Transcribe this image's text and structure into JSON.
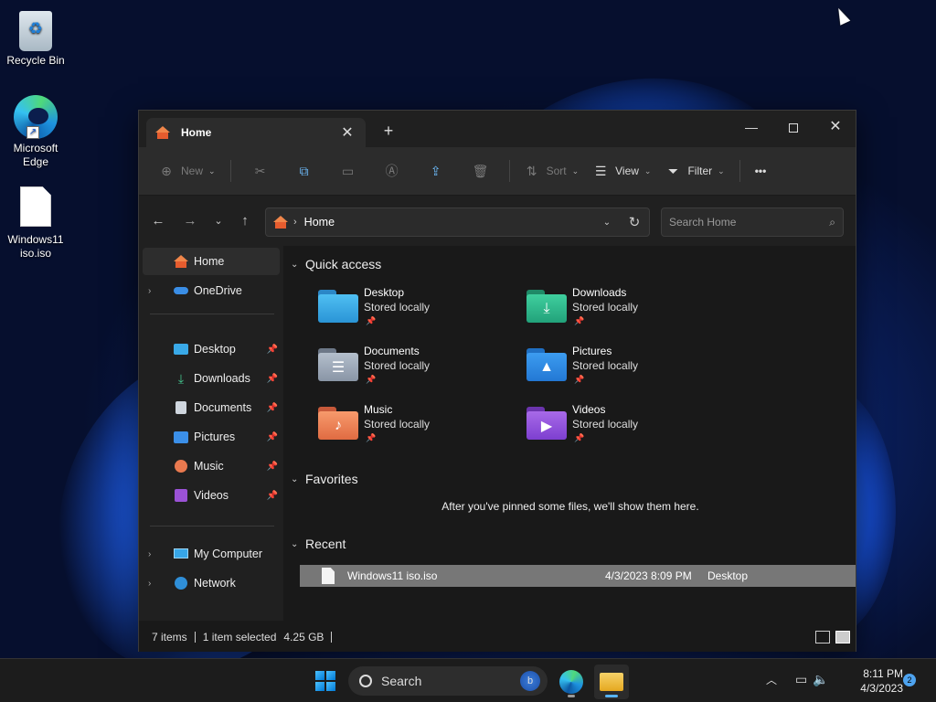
{
  "desktop": {
    "icons": [
      {
        "label": "Recycle Bin"
      },
      {
        "label": "Microsoft Edge"
      },
      {
        "label": "Windows11 iso.iso"
      }
    ]
  },
  "window": {
    "tab_title": "Home",
    "toolbar": {
      "new_label": "New",
      "sort_label": "Sort",
      "view_label": "View",
      "filter_label": "Filter",
      "more_label": "•••"
    },
    "address": {
      "path": "Home"
    },
    "search": {
      "placeholder": "Search Home"
    },
    "sidebar": {
      "home": "Home",
      "onedrive": "OneDrive",
      "pinned": [
        "Desktop",
        "Downloads",
        "Documents",
        "Pictures",
        "Music",
        "Videos"
      ],
      "my_computer": "My Computer",
      "network": "Network"
    },
    "quick_access": {
      "heading": "Quick access",
      "items": [
        {
          "name": "Desktop",
          "status": "Stored locally",
          "color": "#39a9e8"
        },
        {
          "name": "Downloads",
          "status": "Stored locally",
          "color": "#30b58a"
        },
        {
          "name": "Documents",
          "status": "Stored locally",
          "color": "#8a97a8"
        },
        {
          "name": "Pictures",
          "status": "Stored locally",
          "color": "#2f8fe5"
        },
        {
          "name": "Music",
          "status": "Stored locally",
          "color": "#e8794e"
        },
        {
          "name": "Videos",
          "status": "Stored locally",
          "color": "#8e4fd3"
        }
      ]
    },
    "favorites": {
      "heading": "Favorites",
      "empty_message": "After you've pinned some files, we'll show them here."
    },
    "recent": {
      "heading": "Recent",
      "rows": [
        {
          "name": "Windows11 iso.iso",
          "date": "4/3/2023 8:09 PM",
          "location": "Desktop"
        }
      ]
    },
    "status": {
      "items": "7 items",
      "selected": "1 item selected",
      "size": "4.25 GB"
    }
  },
  "taskbar": {
    "search_label": "Search",
    "time": "8:11 PM",
    "date": "4/3/2023",
    "notification_count": "2"
  }
}
